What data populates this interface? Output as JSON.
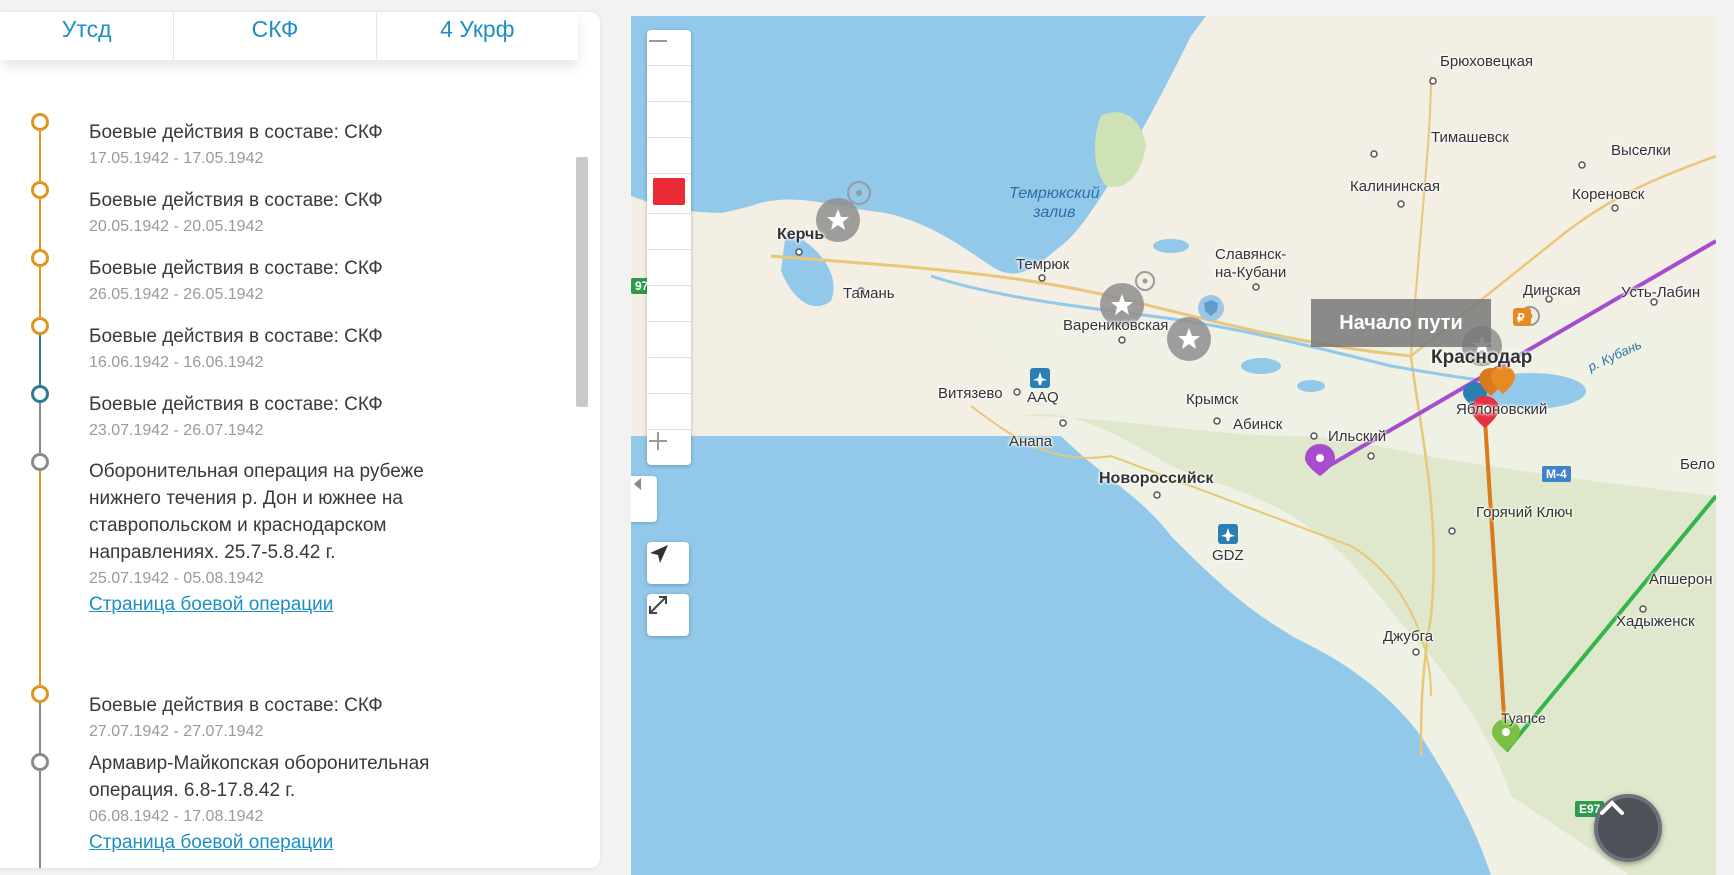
{
  "tabs": [
    "Утсд",
    "СКФ",
    "4 Укрф"
  ],
  "timeline": [
    {
      "title": "Боевые действия в составе: СКФ",
      "date": "17.05.1942 - 17.05.1942",
      "color": "#e09422"
    },
    {
      "title": "Боевые действия в составе: СКФ",
      "date": "20.05.1942 - 20.05.1942",
      "color": "#e09422"
    },
    {
      "title": "Боевые действия в составе: СКФ",
      "date": "26.05.1942 - 26.05.1942",
      "color": "#e09422"
    },
    {
      "title": "Боевые действия в составе: СКФ",
      "date": "16.06.1942 - 16.06.1942",
      "color": "#e09422"
    },
    {
      "title": "Боевые действия в составе: СКФ",
      "date": "23.07.1942 - 26.07.1942",
      "color": "#2c7a94"
    },
    {
      "title_lines": [
        "Оборонительная операция на рубеже",
        "нижнего течения р. Дон и южнее на",
        "ставропольском и краснодарском",
        "направлениях. 25.7-5.8.42 г."
      ],
      "date": "25.07.1942 - 05.08.1942",
      "link": "Страница боевой операции",
      "color": "#8a8a8a"
    },
    {
      "title": "Боевые действия в составе: СКФ",
      "date": "27.07.1942 - 27.07.1942",
      "color": "#e09422"
    },
    {
      "title_lines": [
        "Армавир-Майкопская оборонительная",
        "операция. 6.8-17.8.42 г."
      ],
      "date": "06.08.1942 - 17.08.1942",
      "link": "Страница боевой операции",
      "color": "#8a8a8a"
    }
  ],
  "map": {
    "tooltip": "Начало пути",
    "places": {
      "bryukhovetskaya": "Брюховецкая",
      "timashevsk": "Тимашевск",
      "vyselki": "Выселки",
      "kalininskaya": "Калининская",
      "korenovsk": "Кореновск",
      "gulf": [
        "Темрюкский",
        "залив"
      ],
      "kerch": "Керчь",
      "temryuk": "Темрюк",
      "slavyansk": [
        "Славянск-",
        "на-Кубани"
      ],
      "dinskaya": "Динская",
      "ust_labinsk": "Усть-Лабин",
      "taman": "Тамань",
      "varenikovskaya": "Варениковская",
      "krasnodar": "Краснодар",
      "river_kuban": "р. Кубань",
      "vityazevo": "Витязево",
      "aaq": "AAQ",
      "krymsk": "Крымск",
      "yablonovsky": "Яблоновский",
      "anapa": "Анапа",
      "abinsk": "Абинск",
      "ilsky": "Ильский",
      "novorossiysk": "Новороссийск",
      "m4": "М-4",
      "belo": "Бело",
      "goryachiy_klyuch": "Горячий Ключ",
      "gdz": "GDZ",
      "apsheronsk": "Апшерон",
      "khadyzhensk": "Хадыженск",
      "dzhubga": "Джубга",
      "tuapse": "Туапсе",
      "e97": "E97",
      "e97_left": "97"
    },
    "route_colors": {
      "purple": "#a64ccf",
      "orange": "#d97b1c",
      "green": "#34b54a",
      "red_marker": "#e53240"
    }
  }
}
